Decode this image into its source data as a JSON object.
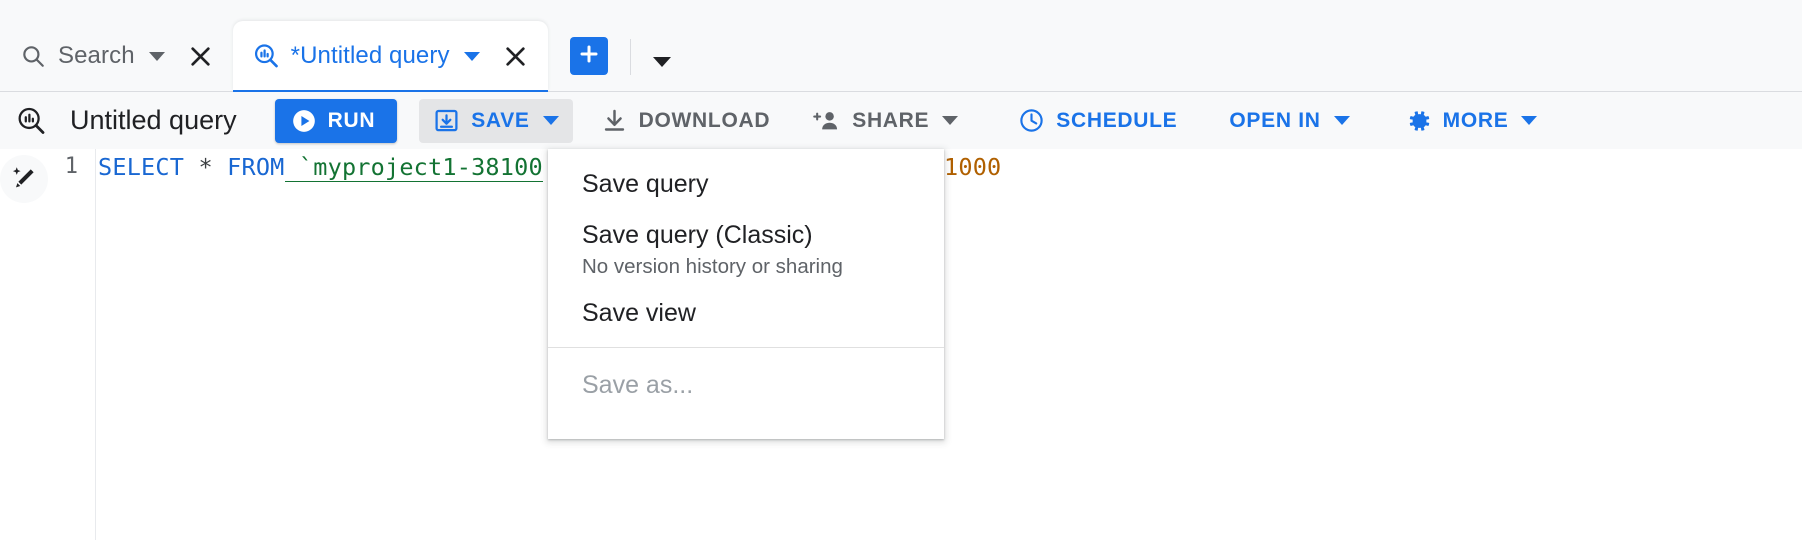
{
  "tabs": [
    {
      "label": "Search",
      "icon": "search-icon",
      "state": "inactive",
      "close_icon": "close-icon",
      "caret_icon": "chevron-down-icon"
    },
    {
      "label": "*Untitled query",
      "icon": "query-icon",
      "state": "active",
      "close_icon": "close-icon",
      "caret_icon": "chevron-down-icon"
    }
  ],
  "tabbar": {
    "add_tab_icon": "plus-icon",
    "overflow_caret_icon": "chevron-down-icon"
  },
  "toolbar": {
    "query_icon": "query-icon",
    "title": "Untitled query",
    "buttons": [
      {
        "label": "RUN",
        "icon": "play-circle-icon",
        "style": "primary",
        "caret": false
      },
      {
        "label": "SAVE",
        "icon": "save-download-icon",
        "style": "blue-pressed",
        "caret": true
      },
      {
        "label": "DOWNLOAD",
        "icon": "download-icon",
        "style": "grey",
        "caret": false
      },
      {
        "label": "SHARE",
        "icon": "person-add-icon",
        "style": "grey",
        "caret": true
      },
      {
        "label": "SCHEDULE",
        "icon": "clock-icon",
        "style": "blue",
        "caret": false
      },
      {
        "label": "OPEN IN",
        "icon": "",
        "style": "blue",
        "caret": true
      },
      {
        "label": "MORE",
        "icon": "gear-icon",
        "style": "blue",
        "caret": true
      }
    ]
  },
  "editor": {
    "assist_icon": "magic-pencil-icon",
    "line_number": "1",
    "code": {
      "select": "SELECT",
      "star": " * ",
      "from": "FROM",
      "table": " `myproject1-38100",
      "limit_value": "1000"
    }
  },
  "save_menu": {
    "groups": [
      {
        "items": [
          {
            "label": "Save query",
            "sub": "",
            "disabled": false
          },
          {
            "label": "Save query (Classic)",
            "sub": "No version history or sharing",
            "disabled": false
          },
          {
            "label": "Save view",
            "sub": "",
            "disabled": false
          }
        ]
      },
      {
        "items": [
          {
            "label": "Save as...",
            "sub": "",
            "disabled": true
          }
        ]
      }
    ]
  },
  "colors": {
    "accent": "#1a73e8",
    "toolbar_bg": "#f8f9fa",
    "keyword": "#1967d2",
    "table": "#137333",
    "number": "#b06000",
    "grey_text": "#5f6368",
    "disabled_text": "#9aa0a6"
  }
}
